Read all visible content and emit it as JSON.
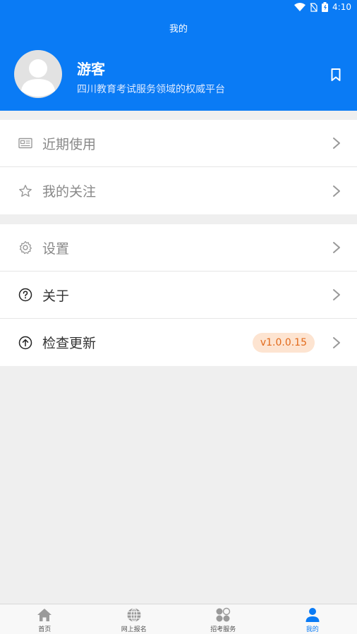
{
  "status_bar": {
    "time": "4:10"
  },
  "header": {
    "title": "我的",
    "username": "游客",
    "tagline": "四川教育考试服务领域的权威平台"
  },
  "menu_group_1": [
    {
      "label": "近期使用",
      "icon": "id-card-icon"
    },
    {
      "label": "我的关注",
      "icon": "star-icon"
    }
  ],
  "menu_group_2": [
    {
      "label": "设置",
      "icon": "gear-icon"
    },
    {
      "label": "关于",
      "icon": "question-circle-icon"
    },
    {
      "label": "检查更新",
      "icon": "arrow-up-circle-icon",
      "badge": "v1.0.0.15"
    }
  ],
  "bottom_nav": [
    {
      "label": "首页",
      "icon": "home-icon"
    },
    {
      "label": "网上报名",
      "icon": "globe-icon"
    },
    {
      "label": "招考服务",
      "icon": "apps-icon"
    },
    {
      "label": "我的",
      "icon": "person-icon",
      "active": true
    }
  ],
  "colors": {
    "primary": "#0a7bf5",
    "badge_bg": "#fde4d1",
    "badge_text": "#e26a1b",
    "background": "#efefef"
  }
}
